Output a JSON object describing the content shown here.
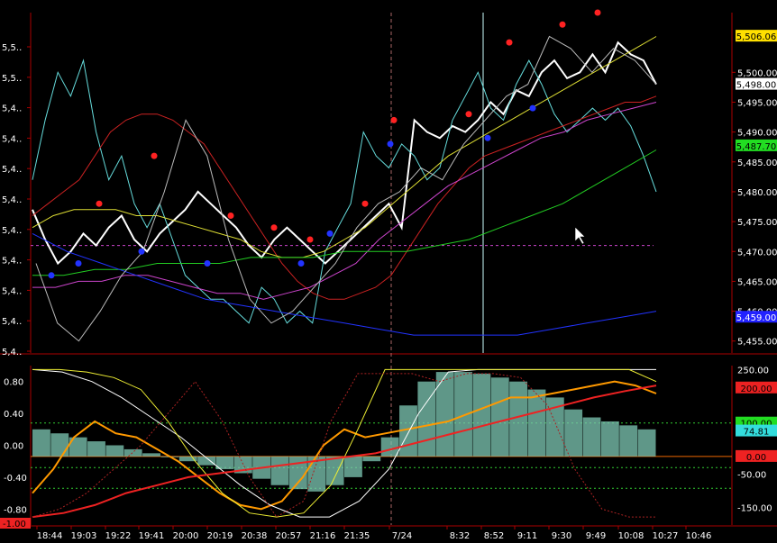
{
  "chart_data": [
    {
      "type": "line",
      "title": "",
      "y_axis_left_ticks": [
        "5,5..",
        "5,5..",
        "5,4..",
        "5,4..",
        "5,4..",
        "5,4..",
        "5,4..",
        "5,4..",
        "5,4..",
        "5,4..",
        "5,4.."
      ],
      "y_axis_right_ticks": [
        "5,500.00",
        "5,495.00",
        "5,490.00",
        "5,485.00",
        "5,480.00",
        "5,475.00",
        "5,470.00",
        "5,465.00",
        "5,460.00",
        "5,455.00"
      ],
      "ylim": [
        5453,
        5510
      ],
      "badges": [
        {
          "text": "5,506.06",
          "value": 5506.06,
          "color": "#ffe000"
        },
        {
          "text": "5,498.00",
          "value": 5498.0,
          "color": "#ffffff"
        },
        {
          "text": "5,487.70",
          "value": 5487.7,
          "color": "#22dd22"
        },
        {
          "text": "5,459.00",
          "value": 5459.0,
          "color": "#2222ff"
        }
      ],
      "reference_line": 5471.0,
      "series": [
        {
          "color": "#ffffff",
          "values": [
            5477,
            5472,
            5468,
            5470,
            5473,
            5471,
            5474,
            5476,
            5472,
            5470,
            5473,
            5475,
            5477,
            5480,
            5478,
            5476,
            5474,
            5471,
            5469,
            5472,
            5474,
            5472,
            5470,
            5468,
            5470,
            5472,
            5474,
            5476,
            5478,
            5474,
            5492,
            5490,
            5489,
            5491,
            5490,
            5492,
            5495,
            5493,
            5497,
            5496,
            5500,
            5502,
            5499,
            5500,
            5503,
            5500,
            5505,
            5503,
            5502,
            5498
          ]
        },
        {
          "color": "#66dddd",
          "values": [
            5482,
            5492,
            5500,
            5496,
            5502,
            5490,
            5482,
            5486,
            5478,
            5474,
            5478,
            5472,
            5466,
            5464,
            5462,
            5462,
            5460,
            5458,
            5464,
            5462,
            5458,
            5460,
            5458,
            5470,
            5474,
            5478,
            5490,
            5486,
            5484,
            5488,
            5486,
            5482,
            5484,
            5492,
            5496,
            5500,
            5494,
            5492,
            5498,
            5502,
            5498,
            5493,
            5490,
            5492,
            5494,
            5492,
            5494,
            5491,
            5486,
            5480
          ]
        },
        {
          "color": "#cc2222",
          "values": [
            5476,
            5478,
            5480,
            5482,
            5486,
            5490,
            5492,
            5493,
            5493,
            5492,
            5490,
            5488,
            5484,
            5480,
            5476,
            5472,
            5468,
            5465,
            5463,
            5462,
            5462,
            5463,
            5464,
            5466,
            5470,
            5474,
            5478,
            5481,
            5484,
            5486,
            5487,
            5488,
            5489,
            5490,
            5491,
            5492,
            5493,
            5494,
            5495,
            5495,
            5496
          ]
        },
        {
          "color": "#dddd33",
          "values": [
            5474,
            5476,
            5477,
            5477,
            5477,
            5476,
            5476,
            5475,
            5474,
            5473,
            5472,
            5470,
            5469,
            5469,
            5470,
            5472,
            5474,
            5477,
            5480,
            5483,
            5486,
            5488,
            5490,
            5492,
            5494,
            5496,
            5498,
            5500,
            5502,
            5504,
            5506
          ]
        },
        {
          "color": "#cc44cc",
          "values": [
            5464,
            5464,
            5465,
            5465,
            5466,
            5466,
            5465,
            5464,
            5463,
            5463,
            5462,
            5463,
            5464,
            5466,
            5468,
            5472,
            5475,
            5478,
            5481,
            5483,
            5485,
            5487,
            5489,
            5490,
            5492,
            5493,
            5494,
            5495
          ]
        },
        {
          "color": "#22cc22",
          "values": [
            5466,
            5466,
            5467,
            5467,
            5468,
            5468,
            5468,
            5469,
            5469,
            5469,
            5470,
            5470,
            5470,
            5471,
            5472,
            5474,
            5476,
            5478,
            5481,
            5484,
            5487
          ]
        },
        {
          "color": "#2233ff",
          "values": [
            5473,
            5470,
            5468,
            5466,
            5464,
            5462,
            5461,
            5460,
            5459,
            5458,
            5457,
            5456,
            5456,
            5456,
            5456,
            5457,
            5458,
            5459,
            5460
          ]
        },
        {
          "color": "#bbbbbb",
          "values": [
            5468,
            5458,
            5455,
            5460,
            5466,
            5470,
            5480,
            5492,
            5486,
            5472,
            5462,
            5458,
            5460,
            5464,
            5468,
            5474,
            5478,
            5480,
            5484,
            5482,
            5488,
            5492,
            5496,
            5498,
            5506,
            5504,
            5500,
            5504,
            5502,
            5498
          ]
        }
      ],
      "dots_red": [
        5478,
        5486,
        5476,
        5474,
        5472,
        5478,
        5492,
        5493,
        5505,
        5508,
        5510
      ],
      "dots_blue": [
        5466,
        5468,
        5470,
        5468,
        5468,
        5473,
        5488,
        5489,
        5494
      ]
    },
    {
      "type": "line",
      "title": "",
      "y_axis_left_ticks": [
        "0.80",
        "0.40",
        "0.00",
        "-0.40",
        "-0.80",
        "-1.00"
      ],
      "y_axis_right_ticks": [
        "250.00",
        "100.00",
        "0.00",
        "-50.00",
        "-150.00"
      ],
      "ylim": [
        -1.0,
        1.0
      ],
      "badges": [
        {
          "text": "200.00",
          "value": 0.72,
          "color": "#ee2222"
        },
        {
          "text": "100.00",
          "value": 0.28,
          "color": "#22dd22"
        },
        {
          "text": "74.81",
          "value": 0.18,
          "color": "#33dddd"
        },
        {
          "text": "0.00",
          "value": -0.14,
          "color": "#ee2222"
        }
      ],
      "reference_lines": [
        0.28,
        -0.14,
        -0.28,
        -0.54
      ],
      "histogram": [
        0.2,
        0.15,
        0.1,
        0.05,
        0,
        -0.05,
        -0.1,
        -0.15,
        -0.2,
        -0.25,
        -0.3,
        -0.35,
        -0.42,
        -0.5,
        -0.55,
        -0.58,
        -0.5,
        -0.4,
        -0.2,
        0.1,
        0.5,
        0.8,
        0.92,
        0.92,
        0.9,
        0.85,
        0.8,
        0.7,
        0.6,
        0.45,
        0.35,
        0.3,
        0.25,
        0.2
      ],
      "series": [
        {
          "color": "#ff9900",
          "values": [
            -0.6,
            -0.3,
            0.1,
            0.3,
            0.15,
            0.1,
            -0.05,
            -0.2,
            -0.4,
            -0.6,
            -0.75,
            -0.8,
            -0.7,
            -0.4,
            0.0,
            0.2,
            0.1,
            0.15,
            0.2,
            0.25,
            0.3,
            0.4,
            0.5,
            0.6,
            0.6,
            0.65,
            0.7,
            0.75,
            0.8,
            0.75,
            0.65
          ]
        },
        {
          "color": "#ffffff",
          "values": [
            0.95,
            0.92,
            0.8,
            0.6,
            0.35,
            0.1,
            -0.2,
            -0.5,
            -0.75,
            -0.9,
            -0.9,
            -0.7,
            -0.3,
            0.4,
            0.92,
            0.95,
            0.95,
            0.95,
            0.95,
            0.95,
            0.95,
            0.95
          ]
        },
        {
          "color": "#eeee33",
          "values": [
            0.95,
            0.95,
            0.92,
            0.85,
            0.7,
            0.3,
            -0.2,
            -0.6,
            -0.85,
            -0.9,
            -0.85,
            -0.5,
            0.2,
            0.95,
            0.95,
            0.95,
            0.95,
            0.95,
            0.95,
            0.95,
            0.95,
            0.95,
            0.95,
            0.8
          ]
        },
        {
          "color": "#ee2222",
          "values": [
            -0.9,
            -0.85,
            -0.75,
            -0.6,
            -0.5,
            -0.4,
            -0.35,
            -0.3,
            -0.25,
            -0.2,
            -0.15,
            -0.1,
            0.0,
            0.1,
            0.2,
            0.3,
            0.4,
            0.5,
            0.6,
            0.68,
            0.75
          ]
        },
        {
          "color": "#aa2222",
          "values": [
            -0.9,
            -0.8,
            -0.6,
            -0.3,
            0.0,
            0.4,
            0.8,
            0.3,
            -0.4,
            -0.9,
            -0.7,
            0.3,
            0.9,
            0.9,
            0.9,
            0.8,
            0.9,
            0.9,
            0.85,
            0.5,
            -0.3,
            -0.8,
            -0.9,
            -0.9
          ]
        }
      ]
    }
  ],
  "x_axis_ticks": [
    "18:44",
    "19:03",
    "19:22",
    "19:41",
    "20:00",
    "20:19",
    "20:38",
    "20:57",
    "21:16",
    "21:35",
    "7/24",
    "8:32",
    "8:52",
    "9:11",
    "9:30",
    "9:49",
    "10:08",
    "10:27",
    "10:46"
  ]
}
